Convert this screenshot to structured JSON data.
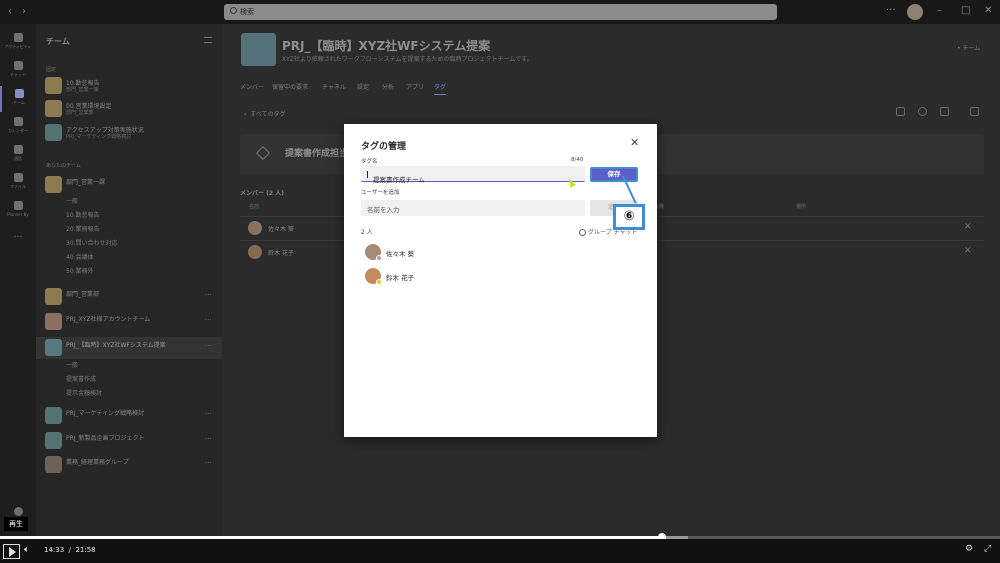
{
  "titlebar": {
    "search_placeholder": "検索",
    "back_icon": "chevron-left-icon",
    "forward_icon": "chevron-right-icon"
  },
  "rail": {
    "items": [
      {
        "label": "アクティビティ",
        "icon": "bell-icon"
      },
      {
        "label": "チャット",
        "icon": "chat-icon"
      },
      {
        "label": "チーム",
        "icon": "teams-icon"
      },
      {
        "label": "カレンダー",
        "icon": "calendar-icon"
      },
      {
        "label": "通話",
        "icon": "phone-icon"
      },
      {
        "label": "ファイル",
        "icon": "file-icon"
      },
      {
        "label": "Planner By",
        "icon": "planner-icon"
      }
    ],
    "more": "…"
  },
  "teams_panel": {
    "title": "チーム",
    "section_fixed": "固定",
    "section_yours": "あなたのチーム",
    "pinned": [
      {
        "name": "10.勤怠報告",
        "sub": "部門_営業一課"
      },
      {
        "name": "00.営業環境設定",
        "sub": "部門_営業部"
      },
      {
        "name": "アクセスアップ対策実施状況",
        "sub": "PRJ_マーケティング戦略検討"
      }
    ],
    "teams": [
      {
        "name": "部門_営業一課",
        "channels": [
          "一般",
          "10.勤怠報告",
          "20.業務報告",
          "30.問い合わせ対応",
          "40.会議体",
          "50.業務外"
        ]
      },
      {
        "name": "部門_営業部",
        "channels": []
      },
      {
        "name": "PRJ_XYZ社様アカウントチーム",
        "channels": []
      },
      {
        "name": "PRJ_【臨時】XYZ社WFシステム提案",
        "channels": [
          "一般",
          "提案書作成",
          "提示金額検討"
        ]
      },
      {
        "name": "PRJ_マーケティング戦略検討",
        "channels": []
      },
      {
        "name": "PRJ_新製品企画プロジェクト",
        "channels": []
      },
      {
        "name": "業務_経理業務グループ",
        "channels": []
      }
    ],
    "more": "···"
  },
  "main": {
    "title": "PRJ_【臨時】XYZ社WFシステム提案",
    "title_more": "···",
    "description": "XYZ社より依頼されたワークフローシステムを提案するための臨時プロジェクトチームです。",
    "team_link": "• チーム",
    "tabs": [
      "メンバー",
      "保留中の要求",
      "チャネル",
      "設定",
      "分析",
      "アプリ",
      "タグ"
    ],
    "back_link": "すべてのタグ",
    "tag_name": "提案書作成担当",
    "members_header": "メンバー (2 人)",
    "col_name": "名前",
    "col_title": "役職",
    "col_location": "場所",
    "members": [
      "佐々木 葵",
      "鈴木 花子"
    ]
  },
  "modal": {
    "title": "タグの管理",
    "tag_name_label": "タグ名",
    "char_count": "8/40",
    "tag_name_value": "提案書作成チーム",
    "save_label": "保存",
    "add_user_label": "ユーザーを追加",
    "add_user_placeholder": "名前を入力",
    "add_button_label": "追加",
    "member_count": "2 人",
    "group_chat_label": "グループ チャット",
    "members": [
      {
        "name": "佐々木 葵",
        "status_color": "#a6a6a6"
      },
      {
        "name": "鈴木 花子",
        "status_color": "#f8c12c"
      }
    ],
    "close_icon": "close-icon"
  },
  "annotation": {
    "step_number": "⑥"
  },
  "player": {
    "tooltip": "再生",
    "current_time": "14:33",
    "separator": "/",
    "total_time": "21:58",
    "progress": 0.662,
    "buffered": 0.688,
    "play_icon": "play-icon",
    "volume_icon": "volume-icon",
    "settings_icon": "gear-icon",
    "fullscreen_icon": "fullscreen-icon"
  },
  "colors": {
    "accent": "#5b5fc7",
    "callout": "#3e8ed0"
  }
}
